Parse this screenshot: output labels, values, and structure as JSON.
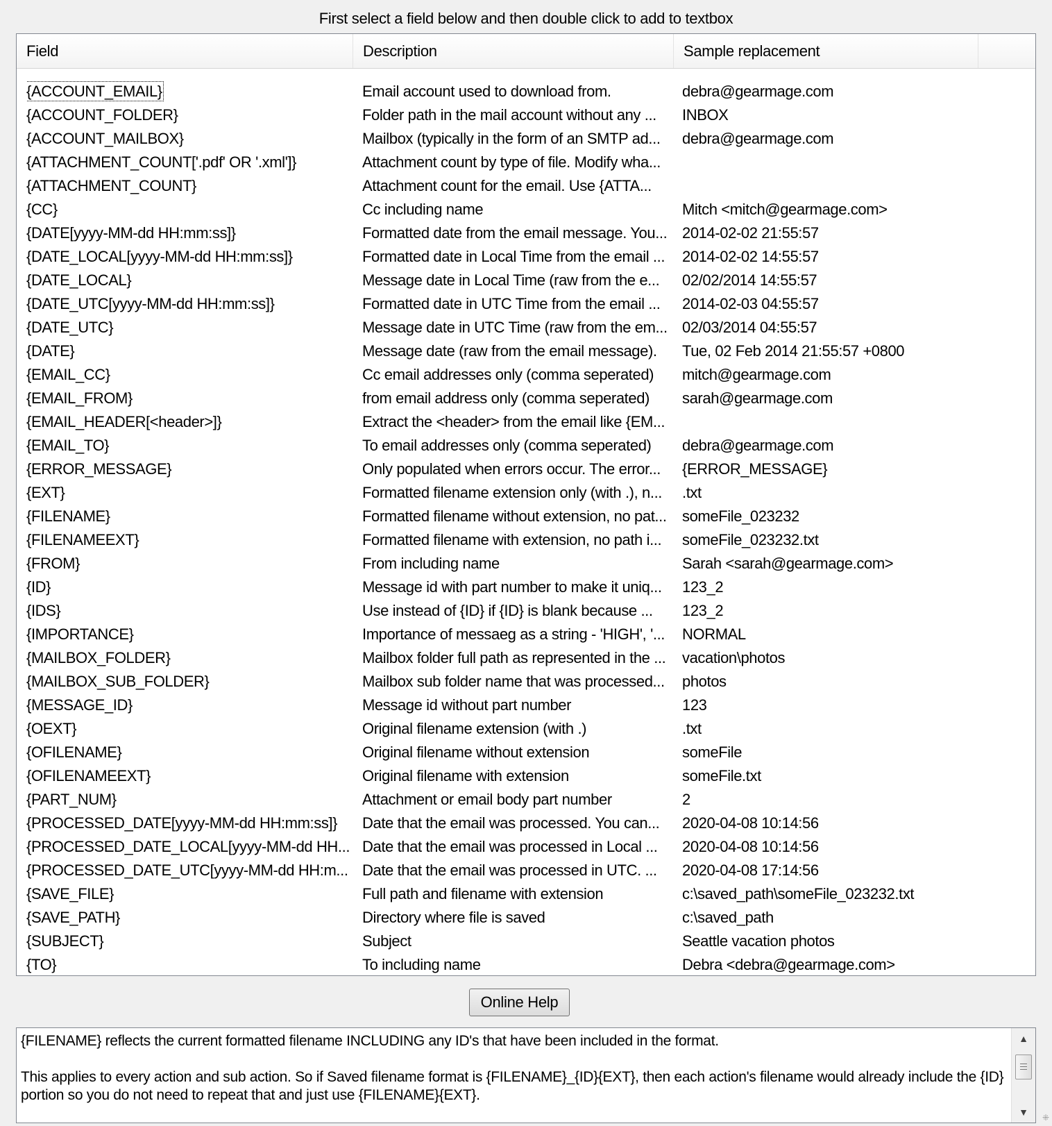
{
  "instruction": "First select a field below and then double click to add to textbox",
  "table": {
    "columns": [
      "Field",
      "Description",
      "Sample replacement"
    ],
    "rows": [
      {
        "field": "{ACCOUNT_EMAIL}",
        "description": "Email account used to download from.",
        "sample": "debra@gearmage.com"
      },
      {
        "field": "{ACCOUNT_FOLDER}",
        "description": "Folder path in the mail account without any ...",
        "sample": "INBOX"
      },
      {
        "field": "{ACCOUNT_MAILBOX}",
        "description": "Mailbox (typically in the form of an SMTP ad...",
        "sample": "debra@gearmage.com"
      },
      {
        "field": "{ATTACHMENT_COUNT['.pdf' OR '.xml']}",
        "description": "Attachment count by type of file. Modify wha...",
        "sample": ""
      },
      {
        "field": "{ATTACHMENT_COUNT}",
        "description": "Attachment count for the email. Use {ATTA...",
        "sample": ""
      },
      {
        "field": "{CC}",
        "description": "Cc including name",
        "sample": "Mitch <mitch@gearmage.com>"
      },
      {
        "field": "{DATE[yyyy-MM-dd HH:mm:ss]}",
        "description": "Formatted date from the email message. You...",
        "sample": "2014-02-02 21:55:57"
      },
      {
        "field": "{DATE_LOCAL[yyyy-MM-dd HH:mm:ss]}",
        "description": "Formatted date in Local Time from the email ...",
        "sample": "2014-02-02 14:55:57"
      },
      {
        "field": "{DATE_LOCAL}",
        "description": "Message date in Local Time (raw from the e...",
        "sample": "02/02/2014 14:55:57"
      },
      {
        "field": "{DATE_UTC[yyyy-MM-dd HH:mm:ss]}",
        "description": "Formatted date in UTC Time from the email ...",
        "sample": "2014-02-03 04:55:57"
      },
      {
        "field": "{DATE_UTC}",
        "description": "Message date in UTC Time (raw from the em...",
        "sample": "02/03/2014 04:55:57"
      },
      {
        "field": "{DATE}",
        "description": "Message date (raw from the email message).",
        "sample": "Tue, 02 Feb 2014 21:55:57 +0800"
      },
      {
        "field": "{EMAIL_CC}",
        "description": "Cc email addresses only (comma seperated)",
        "sample": "mitch@gearmage.com"
      },
      {
        "field": "{EMAIL_FROM}",
        "description": "from email address only (comma seperated)",
        "sample": "sarah@gearmage.com"
      },
      {
        "field": "{EMAIL_HEADER[<header>]}",
        "description": "Extract the <header> from the email like {EM...",
        "sample": ""
      },
      {
        "field": "{EMAIL_TO}",
        "description": "To email addresses only (comma seperated)",
        "sample": "debra@gearmage.com"
      },
      {
        "field": "{ERROR_MESSAGE}",
        "description": "Only populated when errors occur. The error...",
        "sample": "{ERROR_MESSAGE}"
      },
      {
        "field": "{EXT}",
        "description": "Formatted filename extension only (with .), n...",
        "sample": ".txt"
      },
      {
        "field": "{FILENAME}",
        "description": "Formatted filename without extension, no pat...",
        "sample": "someFile_023232"
      },
      {
        "field": "{FILENAMEEXT}",
        "description": "Formatted filename with extension, no path i...",
        "sample": "someFile_023232.txt"
      },
      {
        "field": "{FROM}",
        "description": "From including name",
        "sample": "Sarah <sarah@gearmage.com>"
      },
      {
        "field": "{ID}",
        "description": "Message id with part number to make it uniq...",
        "sample": "123_2"
      },
      {
        "field": "{IDS}",
        "description": "Use instead of {ID} if {ID} is blank because ...",
        "sample": "123_2"
      },
      {
        "field": "{IMPORTANCE}",
        "description": "Importance of messaeg as a string - 'HIGH', '...",
        "sample": "NORMAL"
      },
      {
        "field": "{MAILBOX_FOLDER}",
        "description": "Mailbox folder full path as represented in the ...",
        "sample": "vacation\\photos"
      },
      {
        "field": "{MAILBOX_SUB_FOLDER}",
        "description": "Mailbox sub folder name that was processed...",
        "sample": "photos"
      },
      {
        "field": "{MESSAGE_ID}",
        "description": "Message id without part number",
        "sample": "123"
      },
      {
        "field": "{OEXT}",
        "description": "Original filename extension (with .)",
        "sample": ".txt"
      },
      {
        "field": "{OFILENAME}",
        "description": "Original filename without extension",
        "sample": "someFile"
      },
      {
        "field": "{OFILENAMEEXT}",
        "description": "Original filename with extension",
        "sample": "someFile.txt"
      },
      {
        "field": "{PART_NUM}",
        "description": "Attachment or email body part number",
        "sample": "2"
      },
      {
        "field": "{PROCESSED_DATE[yyyy-MM-dd HH:mm:ss]}",
        "description": "Date that the email was processed. You can...",
        "sample": "2020-04-08 10:14:56"
      },
      {
        "field": "{PROCESSED_DATE_LOCAL[yyyy-MM-dd HH...",
        "description": "Date that the email was processed in Local ...",
        "sample": "2020-04-08 10:14:56"
      },
      {
        "field": "{PROCESSED_DATE_UTC[yyyy-MM-dd HH:m...",
        "description": "Date that the email was processed in UTC. ...",
        "sample": "2020-04-08 17:14:56"
      },
      {
        "field": "{SAVE_FILE}",
        "description": " Full path and filename with extension",
        "sample": "c:\\saved_path\\someFile_023232.txt"
      },
      {
        "field": "{SAVE_PATH}",
        "description": "Directory where file is saved",
        "sample": "c:\\saved_path"
      },
      {
        "field": "{SUBJECT}",
        "description": "Subject",
        "sample": "Seattle vacation photos"
      },
      {
        "field": "{TO}",
        "description": "To including name",
        "sample": "Debra <debra@gearmage.com>"
      }
    ]
  },
  "help_button": "Online Help",
  "notes": {
    "line1": "{FILENAME} reflects the current formatted filename INCLUDING any ID's that have been included in the format.",
    "line2": "This applies to every action and sub action. So if Saved filename format is {FILENAME}_{ID}{EXT}, then each action's filename would already include the {ID} portion so you do not need to repeat that and just use {FILENAME}{EXT}."
  },
  "icons": {
    "scroll_up": "scroll-up-arrow-icon",
    "scroll_down": "scroll-down-arrow-icon",
    "resize_grip": "resize-grip-icon"
  }
}
